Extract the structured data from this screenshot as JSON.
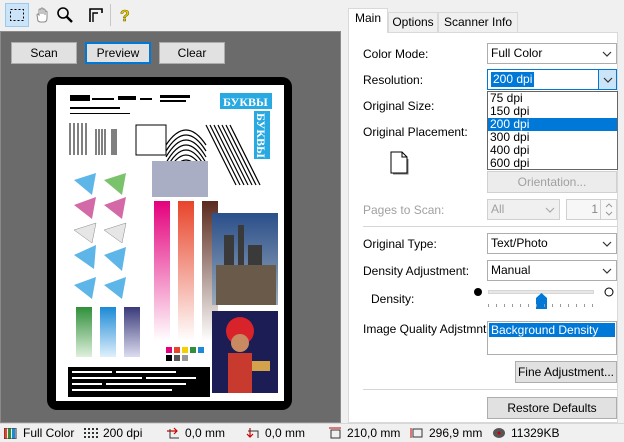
{
  "toolbar": {
    "tools": [
      "select-rect-icon",
      "hand-icon",
      "zoom-icon",
      "crop-corner-icon",
      "help-icon"
    ]
  },
  "preview": {
    "scan_label": "Scan",
    "preview_label": "Preview",
    "clear_label": "Clear",
    "sample_text": {
      "cyrillic_title": "БУКВЫ",
      "cyrillic_side": "БУКВЫ"
    }
  },
  "tabs": [
    "Main",
    "Options",
    "Scanner Info"
  ],
  "main": {
    "color_mode_label": "Color Mode:",
    "color_mode_value": "Full Color",
    "resolution_label": "Resolution:",
    "resolution_value": "200 dpi",
    "resolution_options": [
      "75 dpi",
      "150 dpi",
      "200 dpi",
      "300 dpi",
      "400 dpi",
      "600 dpi"
    ],
    "resolution_selected_index": 2,
    "original_size_label": "Original Size:",
    "original_placement_label": "Original Placement:",
    "orientation_label": "Orientation...",
    "pages_label": "Pages to Scan:",
    "pages_value": "All",
    "pages_count": "1",
    "original_type_label": "Original Type:",
    "original_type_value": "Text/Photo",
    "density_adj_label": "Density Adjustment:",
    "density_adj_value": "Manual",
    "density_label": "Density:",
    "density_level": 0.5,
    "iq_label": "Image Quality Adjstmnt:",
    "iq_items": [
      "Background Density"
    ],
    "fine_adj_label": "Fine Adjustment...",
    "restore_label": "Restore Defaults"
  },
  "status": {
    "color_mode": "Full Color",
    "dpi": "200 dpi",
    "x_offset": "0,0 mm",
    "y_offset": "0,0 mm",
    "width": "210,0 mm",
    "height": "296,9 mm",
    "size": "11329KB"
  },
  "colors": {
    "accent": "#0078d7",
    "preview_bg": "#6b6b6b"
  }
}
